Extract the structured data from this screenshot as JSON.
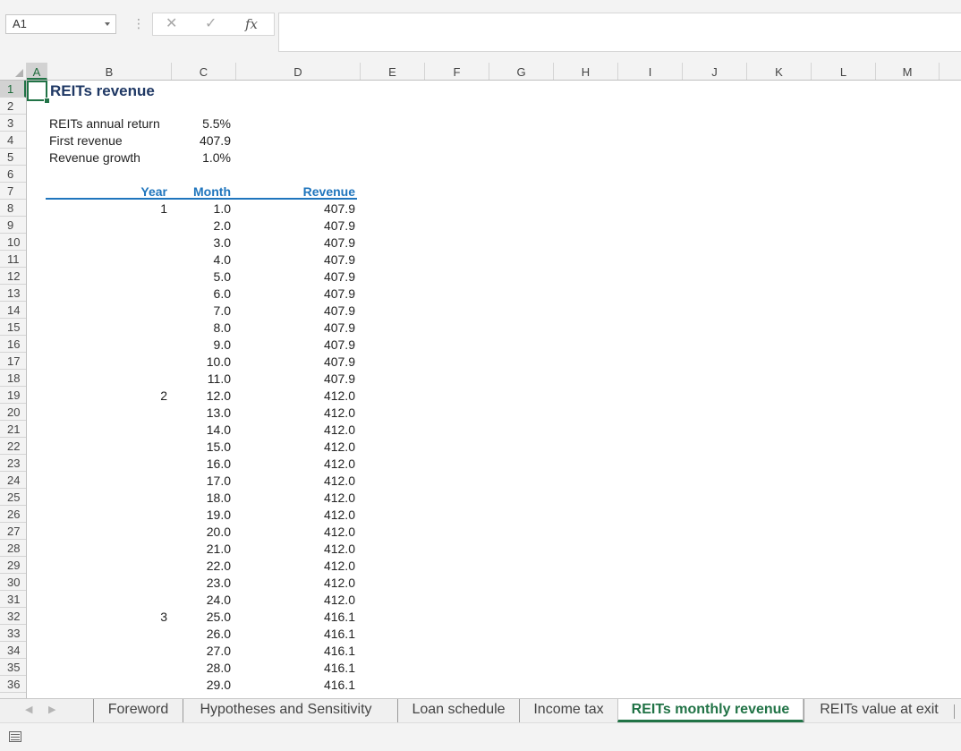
{
  "formula_bar": {
    "name_box": "A1",
    "cancel_glyph": "✕",
    "enter_glyph": "✓",
    "fx_label": "fx",
    "formula": ""
  },
  "columns": [
    "A",
    "B",
    "C",
    "D",
    "E",
    "F",
    "G",
    "H",
    "I",
    "J",
    "K",
    "L",
    "M"
  ],
  "rows": [
    "1",
    "2",
    "3",
    "4",
    "5",
    "6",
    "7",
    "8",
    "9",
    "10",
    "11",
    "12",
    "13",
    "14",
    "15",
    "16",
    "17",
    "18",
    "19",
    "20",
    "21",
    "22",
    "23",
    "24",
    "25",
    "26",
    "27",
    "28",
    "29",
    "30",
    "31",
    "32",
    "33",
    "34",
    "35",
    "36"
  ],
  "sheet": {
    "title": "REITs revenue",
    "inputs": [
      {
        "label": "REITs annual return",
        "value": "5.5%"
      },
      {
        "label": "First revenue",
        "value": "407.9"
      },
      {
        "label": "Revenue growth",
        "value": "1.0%"
      }
    ],
    "table_headers": {
      "year": "Year",
      "month": "Month",
      "revenue": "Revenue"
    },
    "table_rows": [
      {
        "year": "1",
        "month": "1.0",
        "revenue": "407.9"
      },
      {
        "year": "",
        "month": "2.0",
        "revenue": "407.9"
      },
      {
        "year": "",
        "month": "3.0",
        "revenue": "407.9"
      },
      {
        "year": "",
        "month": "4.0",
        "revenue": "407.9"
      },
      {
        "year": "",
        "month": "5.0",
        "revenue": "407.9"
      },
      {
        "year": "",
        "month": "6.0",
        "revenue": "407.9"
      },
      {
        "year": "",
        "month": "7.0",
        "revenue": "407.9"
      },
      {
        "year": "",
        "month": "8.0",
        "revenue": "407.9"
      },
      {
        "year": "",
        "month": "9.0",
        "revenue": "407.9"
      },
      {
        "year": "",
        "month": "10.0",
        "revenue": "407.9"
      },
      {
        "year": "",
        "month": "11.0",
        "revenue": "407.9"
      },
      {
        "year": "2",
        "month": "12.0",
        "revenue": "412.0"
      },
      {
        "year": "",
        "month": "13.0",
        "revenue": "412.0"
      },
      {
        "year": "",
        "month": "14.0",
        "revenue": "412.0"
      },
      {
        "year": "",
        "month": "15.0",
        "revenue": "412.0"
      },
      {
        "year": "",
        "month": "16.0",
        "revenue": "412.0"
      },
      {
        "year": "",
        "month": "17.0",
        "revenue": "412.0"
      },
      {
        "year": "",
        "month": "18.0",
        "revenue": "412.0"
      },
      {
        "year": "",
        "month": "19.0",
        "revenue": "412.0"
      },
      {
        "year": "",
        "month": "20.0",
        "revenue": "412.0"
      },
      {
        "year": "",
        "month": "21.0",
        "revenue": "412.0"
      },
      {
        "year": "",
        "month": "22.0",
        "revenue": "412.0"
      },
      {
        "year": "",
        "month": "23.0",
        "revenue": "412.0"
      },
      {
        "year": "",
        "month": "24.0",
        "revenue": "412.0"
      },
      {
        "year": "3",
        "month": "25.0",
        "revenue": "416.1"
      },
      {
        "year": "",
        "month": "26.0",
        "revenue": "416.1"
      },
      {
        "year": "",
        "month": "27.0",
        "revenue": "416.1"
      },
      {
        "year": "",
        "month": "28.0",
        "revenue": "416.1"
      },
      {
        "year": "",
        "month": "29.0",
        "revenue": "416.1"
      }
    ]
  },
  "tabs": [
    {
      "label": "Foreword",
      "active": false
    },
    {
      "label": "Hypotheses and Sensitivity",
      "active": false
    },
    {
      "label": "Loan schedule",
      "active": false
    },
    {
      "label": "Income tax",
      "active": false
    },
    {
      "label": "REITs monthly revenue",
      "active": true
    },
    {
      "label": "REITs value at exit",
      "active": false
    }
  ],
  "colors": {
    "accent": "#217346",
    "header_blue": "#1f75bd",
    "title_navy": "#1f3864"
  }
}
